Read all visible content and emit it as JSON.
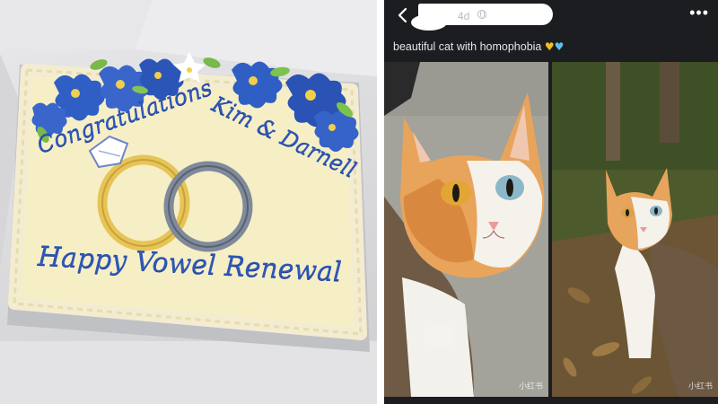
{
  "cake": {
    "line1": "Congratulations",
    "line2": "Kim & Darnell",
    "line3": "Happy Vowel Renewal"
  },
  "post": {
    "time": "4d",
    "caption": "beautiful cat with homophobia",
    "caption_emoji": [
      "yellow-heart",
      "blue-heart"
    ],
    "back_icon": "chevron-left-icon",
    "more_icon": "more-horizontal-icon",
    "visibility_icon": "globe-icon",
    "watermark_left": "小红书",
    "watermark_right": "小红书"
  },
  "colors": {
    "icing_blue": "#2f57b8",
    "post_background": "#1c1d20",
    "heart_yellow": "#f4c020",
    "heart_blue": "#5bc0f0"
  }
}
